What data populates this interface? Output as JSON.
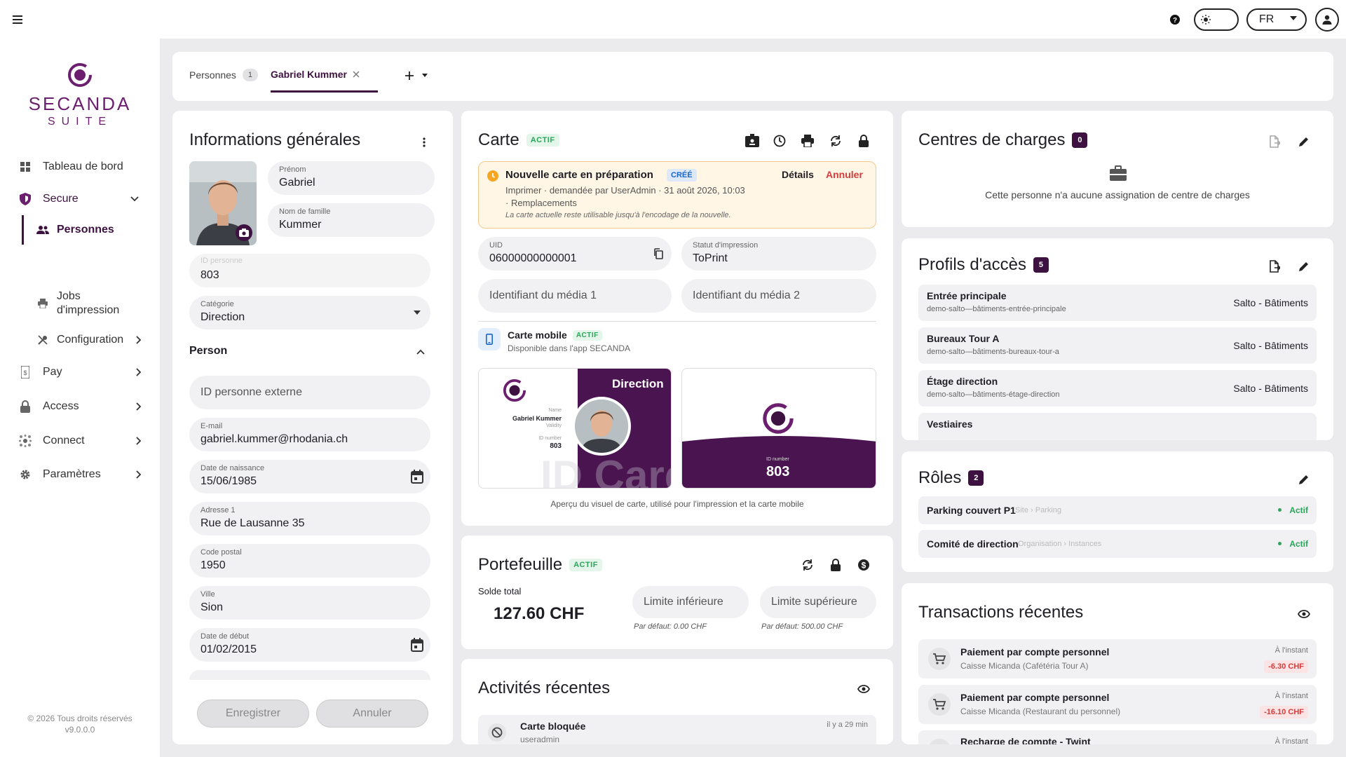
{
  "topbar": {
    "lang": "FR"
  },
  "sidebar": {
    "logo_main": "SECANDA",
    "logo_sub": "SUITE",
    "items": [
      {
        "label": "Tableau de bord",
        "icon": "dashboard-icon"
      },
      {
        "label": "Secure",
        "icon": "shield-icon"
      },
      {
        "label": "Personnes",
        "icon": "people-icon"
      },
      {
        "label": "Jobs d'impression",
        "icon": "printer-icon"
      },
      {
        "label": "Configuration",
        "icon": "tools-icon"
      },
      {
        "label": "Pay",
        "icon": "wallet-icon"
      },
      {
        "label": "Access",
        "icon": "lock-icon"
      },
      {
        "label": "Connect",
        "icon": "network-icon"
      },
      {
        "label": "Paramètres",
        "icon": "gear-icon"
      }
    ],
    "copyright": "© 2026 Tous droits réservés",
    "version": "v9.0.0.0"
  },
  "tabs": [
    {
      "label": "Personnes",
      "count": "1"
    },
    {
      "label": "Gabriel Kummer"
    }
  ],
  "general": {
    "title": "Informations générales",
    "prenom_label": "Prénom",
    "prenom": "Gabriel",
    "nom_label": "Nom de famille",
    "nom": "Kummer",
    "id_label": "ID personne",
    "id": "803",
    "cat_label": "Catégorie",
    "cat": "Direction",
    "section": "Person",
    "ext_ph": "ID personne externe",
    "email_label": "E-mail",
    "email": "gabriel.kummer@rhodania.ch",
    "dob_label": "Date de naissance",
    "dob": "15/06/1985",
    "addr_label": "Adresse 1",
    "addr": "Rue de Lausanne 35",
    "zip_label": "Code postal",
    "zip": "1950",
    "city_label": "Ville",
    "city": "Sion",
    "start_label": "Date de début",
    "start": "01/02/2015",
    "save": "Enregistrer",
    "cancel": "Annuler"
  },
  "carte": {
    "title": "Carte",
    "status": "ACTIF",
    "notice_title": "Nouvelle carte en préparation",
    "notice_badge": "CRÉÉ",
    "notice_details": "Détails",
    "notice_cancel": "Annuler",
    "notice_line1": "Imprimer · demandée par UserAdmin · 31 août 2026, 10:03",
    "notice_line2": "· Remplacements",
    "notice_line3": "La carte actuelle reste utilisable jusqu'à l'encodage de la nouvelle.",
    "uid_label": "UID",
    "uid": "06000000000001",
    "print_label": "Statut d'impression",
    "print": "ToPrint",
    "media1": "Identifiant du média 1",
    "media2": "Identifiant du média 2",
    "mobile_title": "Carte mobile",
    "mobile_status": "ACTIF",
    "mobile_sub": "Disponible dans l'app SECANDA",
    "front_cat": "Direction",
    "front_name_lbl": "Name",
    "front_name": "Gabriel Kummer",
    "front_validity": "Validity",
    "front_id_lbl": "ID number",
    "front_id": "803",
    "front_watermark": "ID Card",
    "back_id_lbl": "ID number",
    "back_id": "803",
    "caption": "Aperçu du visuel de carte, utilisé pour l'impression et la carte mobile"
  },
  "wallet": {
    "title": "Portefeuille",
    "status": "ACTIF",
    "balance_label": "Solde total",
    "balance": "127.60 CHF",
    "low_ph": "Limite inférieure",
    "high_ph": "Limite supérieure",
    "low_hint": "Par défaut: 0.00 CHF",
    "high_hint": "Par défaut: 500.00 CHF"
  },
  "activities": {
    "title": "Activités récentes",
    "items": [
      {
        "title": "Carte bloquée",
        "user": "useradmin",
        "time": "il y a 29 min"
      }
    ]
  },
  "charges": {
    "title": "Centres de charges",
    "count": "0",
    "empty": "Cette personne n'a aucune assignation de centre de charges"
  },
  "access": {
    "title": "Profils d'accès",
    "count": "5",
    "items": [
      {
        "name": "Entrée principale",
        "code": "demo-salto—bâtiments-entrée-principale",
        "sys": "Salto - Bâtiments"
      },
      {
        "name": "Bureaux Tour A",
        "code": "demo-salto—bâtiments-bureaux-tour-a",
        "sys": "Salto - Bâtiments"
      },
      {
        "name": "Étage direction",
        "code": "demo-salto—bâtiments-étage-direction",
        "sys": "Salto - Bâtiments"
      },
      {
        "name": "Vestiaires"
      }
    ]
  },
  "roles": {
    "title": "Rôles",
    "count": "2",
    "items": [
      {
        "name": "Parking couvert P1",
        "path": "Site › Parking",
        "status": "Actif"
      },
      {
        "name": "Comité de direction",
        "path": "Organisation › Instances",
        "status": "Actif"
      }
    ]
  },
  "transactions": {
    "title": "Transactions récentes",
    "items": [
      {
        "title": "Paiement par compte personnel",
        "sub": "Caisse Micanda (Cafétéria Tour A)",
        "time": "À l'instant",
        "amount": "-6.30 CHF"
      },
      {
        "title": "Paiement par compte personnel",
        "sub": "Caisse Micanda (Restaurant du personnel)",
        "time": "À l'instant",
        "amount": "-16.10 CHF"
      },
      {
        "title": "Recharge de compte - Twint",
        "time": "À l'instant"
      }
    ]
  },
  "colors": {
    "brand": "#6b1f6e",
    "dark": "#3d1140",
    "success": "#2aa65a",
    "danger": "#d63b3b",
    "warning": "#f5a623"
  }
}
